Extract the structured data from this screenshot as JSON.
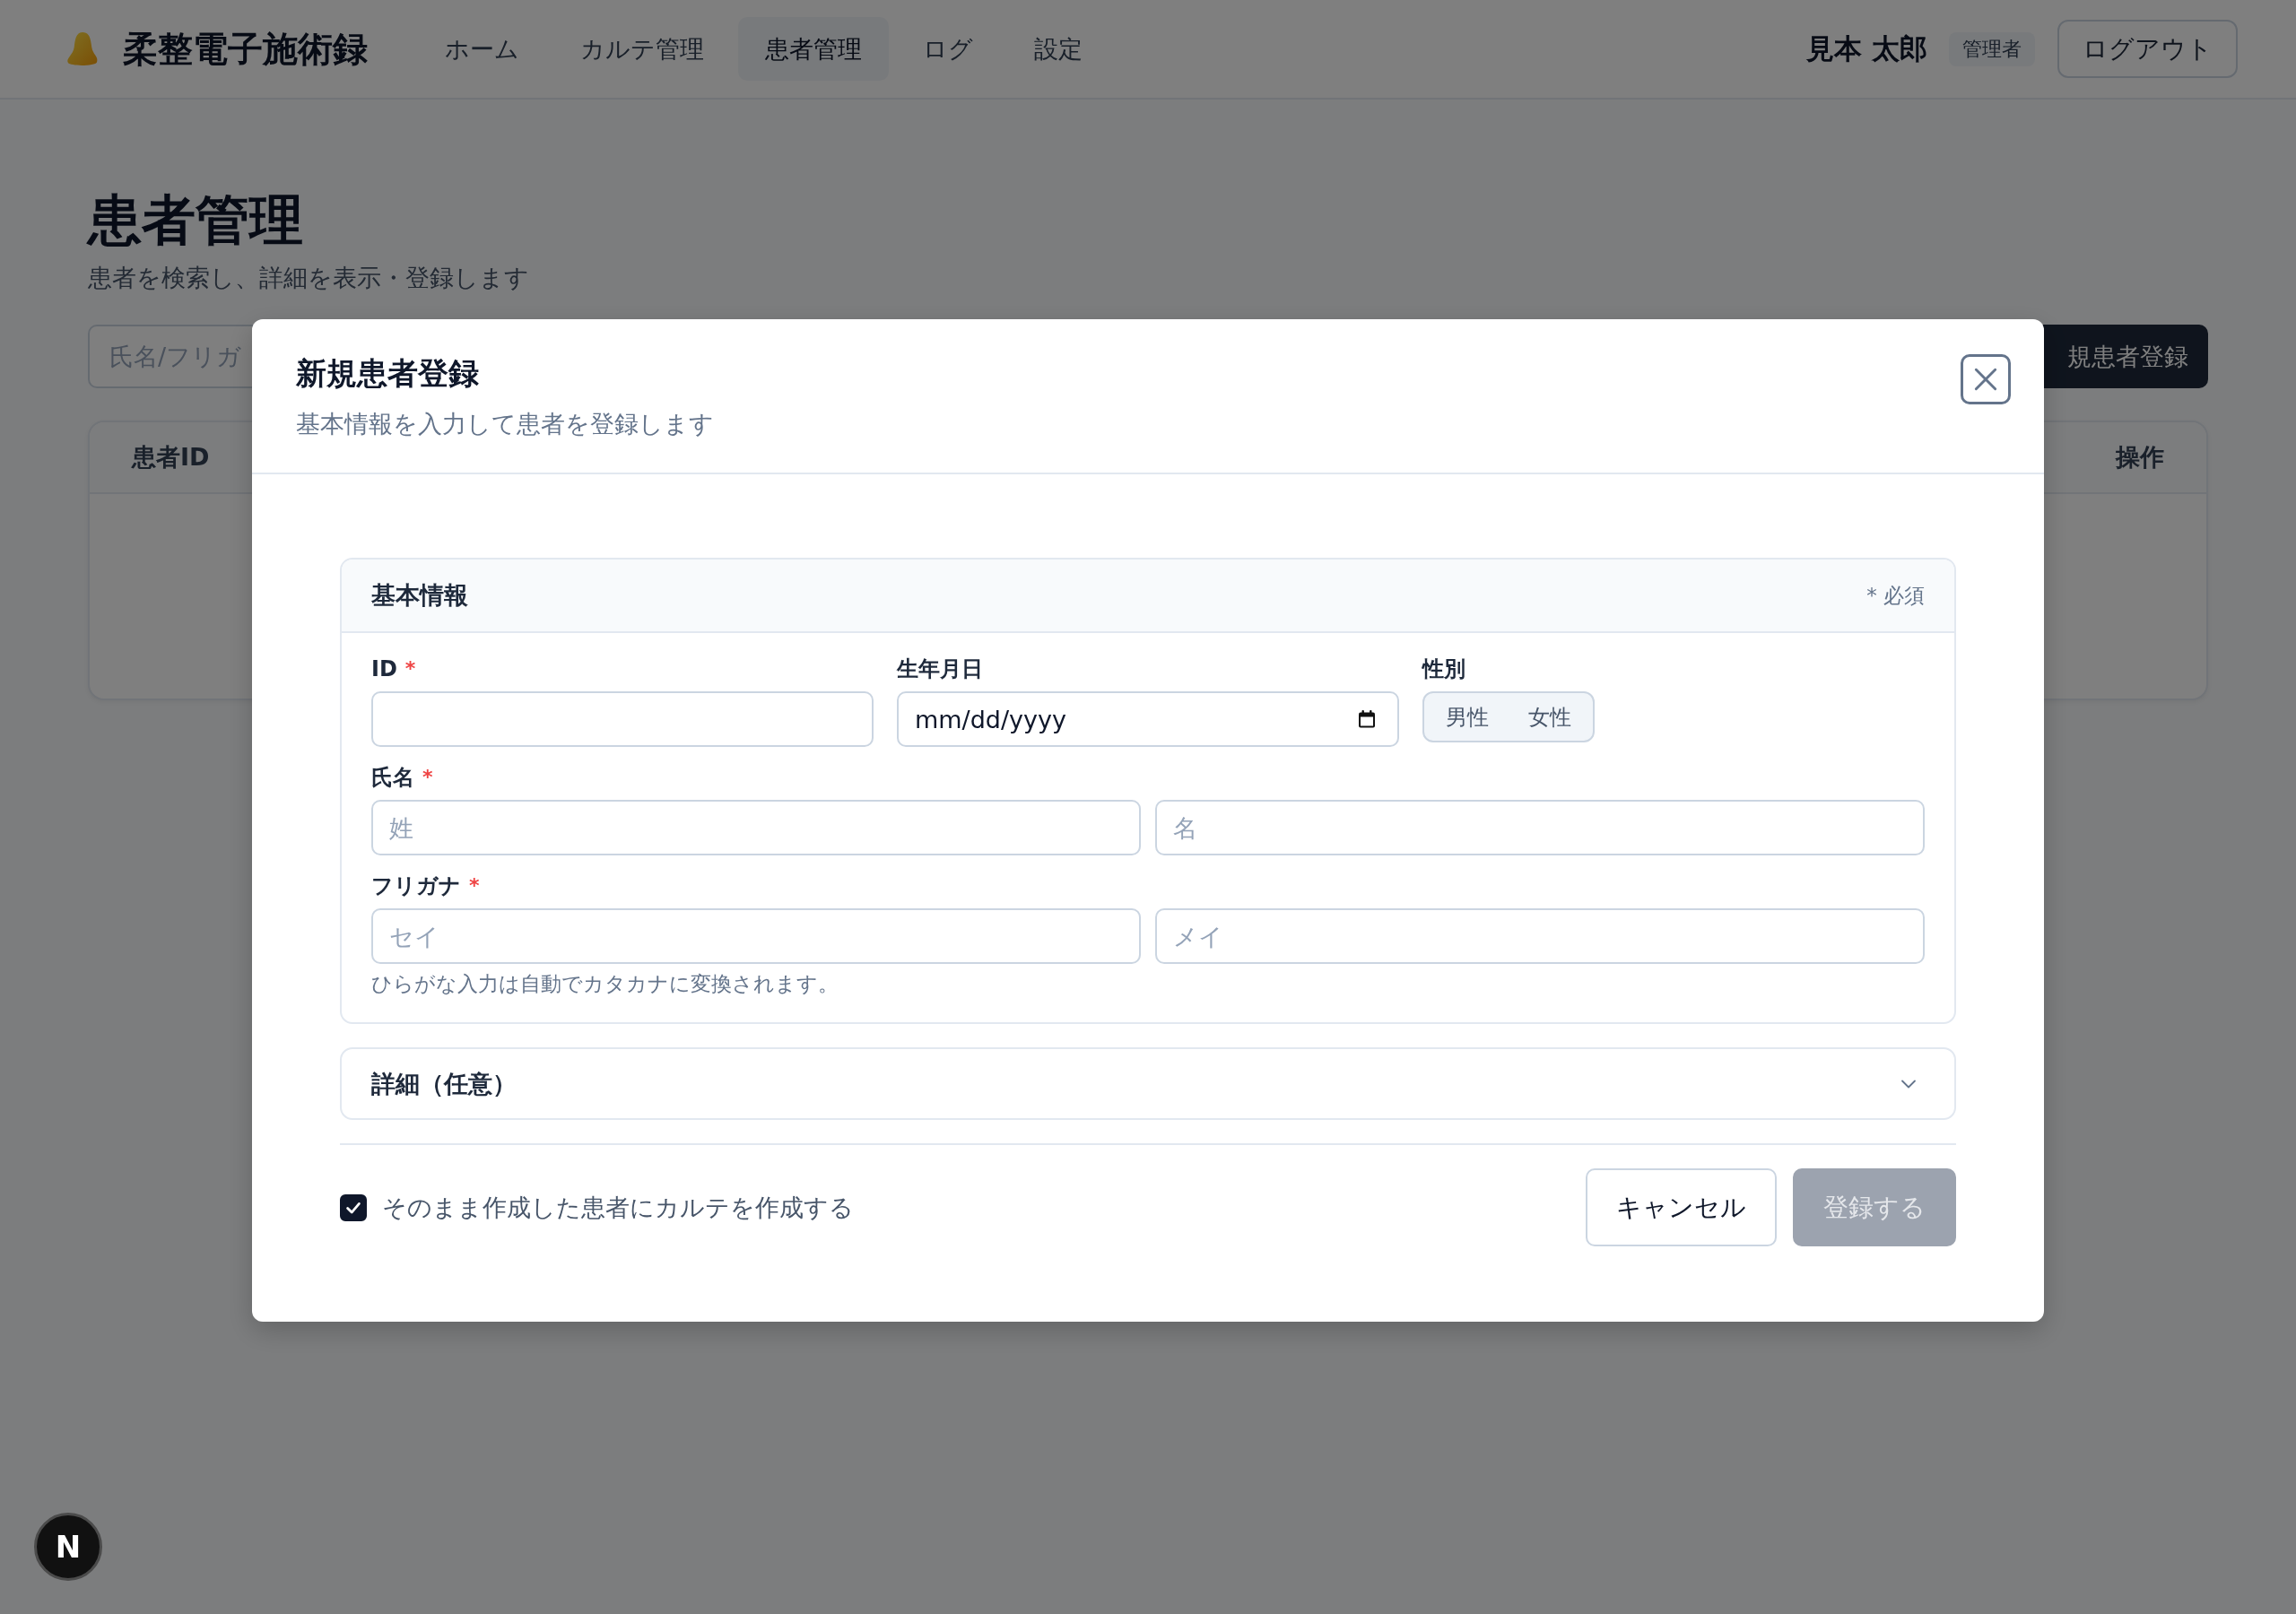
{
  "app": {
    "title": "柔整電子施術録"
  },
  "nav": [
    {
      "label": "ホーム",
      "selected": false
    },
    {
      "label": "カルテ管理",
      "selected": false
    },
    {
      "label": "患者管理",
      "selected": true
    },
    {
      "label": "ログ",
      "selected": false
    },
    {
      "label": "設定",
      "selected": false
    }
  ],
  "user": {
    "name": "見本 太郎",
    "role": "管理者"
  },
  "logout_button": {
    "label": "ログアウト"
  },
  "page": {
    "title": "患者管理",
    "subtitle": "患者を検索し、詳細を表示・登録します"
  },
  "search": {
    "placeholder": "氏名/フリガ"
  },
  "new_patient_button": {
    "label": "規患者登録"
  },
  "table": {
    "columns": [
      "患者ID",
      "操作"
    ]
  },
  "dialog": {
    "title": "新規患者登録",
    "subtitle": "基本情報を入力して患者を登録します",
    "basic_info": {
      "title": "基本情報",
      "legend": "* 必須",
      "required_mark": "*",
      "rows": [
        {
          "fields": [
            {
              "kind": "text",
              "label": "ID",
              "required": true
            },
            {
              "kind": "date",
              "label": "生年月日",
              "required": false,
              "placeholder": "mm/dd/yyyy"
            },
            {
              "kind": "segmented",
              "label": "性別",
              "required": false,
              "options": [
                {
                  "label": "男性",
                  "selected": false
                },
                {
                  "label": "女性",
                  "selected": false
                }
              ]
            }
          ]
        },
        {
          "fields": [
            {
              "kind": "pair",
              "label": "氏名",
              "required": true,
              "inputs": [
                {
                  "placeholder": "姓"
                },
                {
                  "placeholder": "名"
                }
              ]
            }
          ]
        },
        {
          "fields": [
            {
              "kind": "pair",
              "label": "フリガナ",
              "required": true,
              "inputs": [
                {
                  "placeholder": "セイ"
                },
                {
                  "placeholder": "メイ"
                }
              ],
              "help": "ひらがな入力は自動でカタカナに変換されます。"
            }
          ]
        }
      ]
    },
    "details": {
      "title": "詳細（任意）",
      "expanded": false
    },
    "checkbox": {
      "label": "そのまま作成した患者にカルテを作成する",
      "checked": true
    },
    "buttons": [
      {
        "label": "キャンセル",
        "kind": "secondary",
        "disabled": false
      },
      {
        "label": "登録する",
        "kind": "primary",
        "disabled": true
      }
    ]
  },
  "corner_button": {
    "label": "N"
  }
}
